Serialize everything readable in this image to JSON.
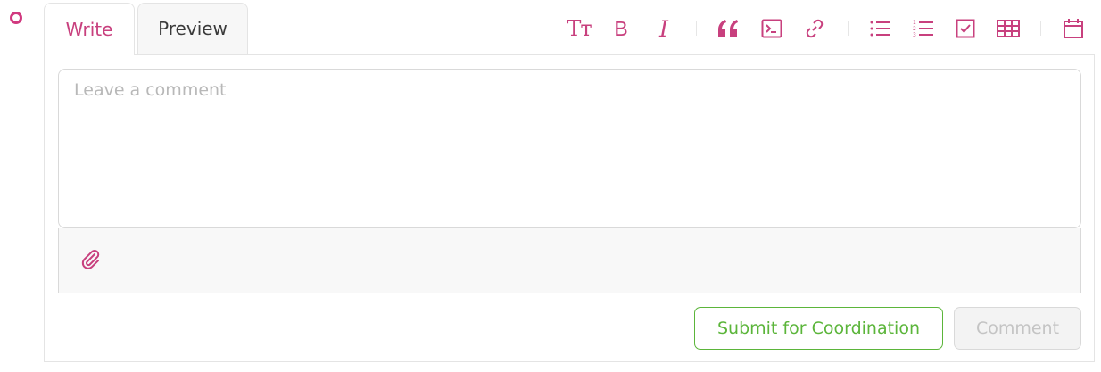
{
  "tabs": {
    "write_label": "Write",
    "preview_label": "Preview"
  },
  "toolbar": {
    "items": [
      {
        "name": "heading",
        "icon": "text-size-icon",
        "glyph": "Tт"
      },
      {
        "name": "bold",
        "icon": "bold-icon",
        "glyph": "B"
      },
      {
        "name": "italic",
        "icon": "italic-icon",
        "glyph": "I"
      },
      {
        "name": "quote",
        "icon": "quote-icon"
      },
      {
        "name": "code",
        "icon": "code-icon"
      },
      {
        "name": "link",
        "icon": "link-icon"
      },
      {
        "name": "bulleted-list",
        "icon": "bulleted-list-icon"
      },
      {
        "name": "numbered-list",
        "icon": "numbered-list-icon"
      },
      {
        "name": "task-list",
        "icon": "checkbox-icon"
      },
      {
        "name": "table",
        "icon": "table-icon"
      },
      {
        "name": "date",
        "icon": "calendar-icon"
      }
    ]
  },
  "comment": {
    "placeholder": "Leave a comment",
    "value": ""
  },
  "attachment": {
    "icon": "paperclip-icon"
  },
  "actions": {
    "submit_label": "Submit for Coordination",
    "comment_label": "Comment"
  },
  "colors": {
    "accent": "#c8407e",
    "success": "#5bb53a",
    "disabled_text": "#c4c4c4"
  }
}
